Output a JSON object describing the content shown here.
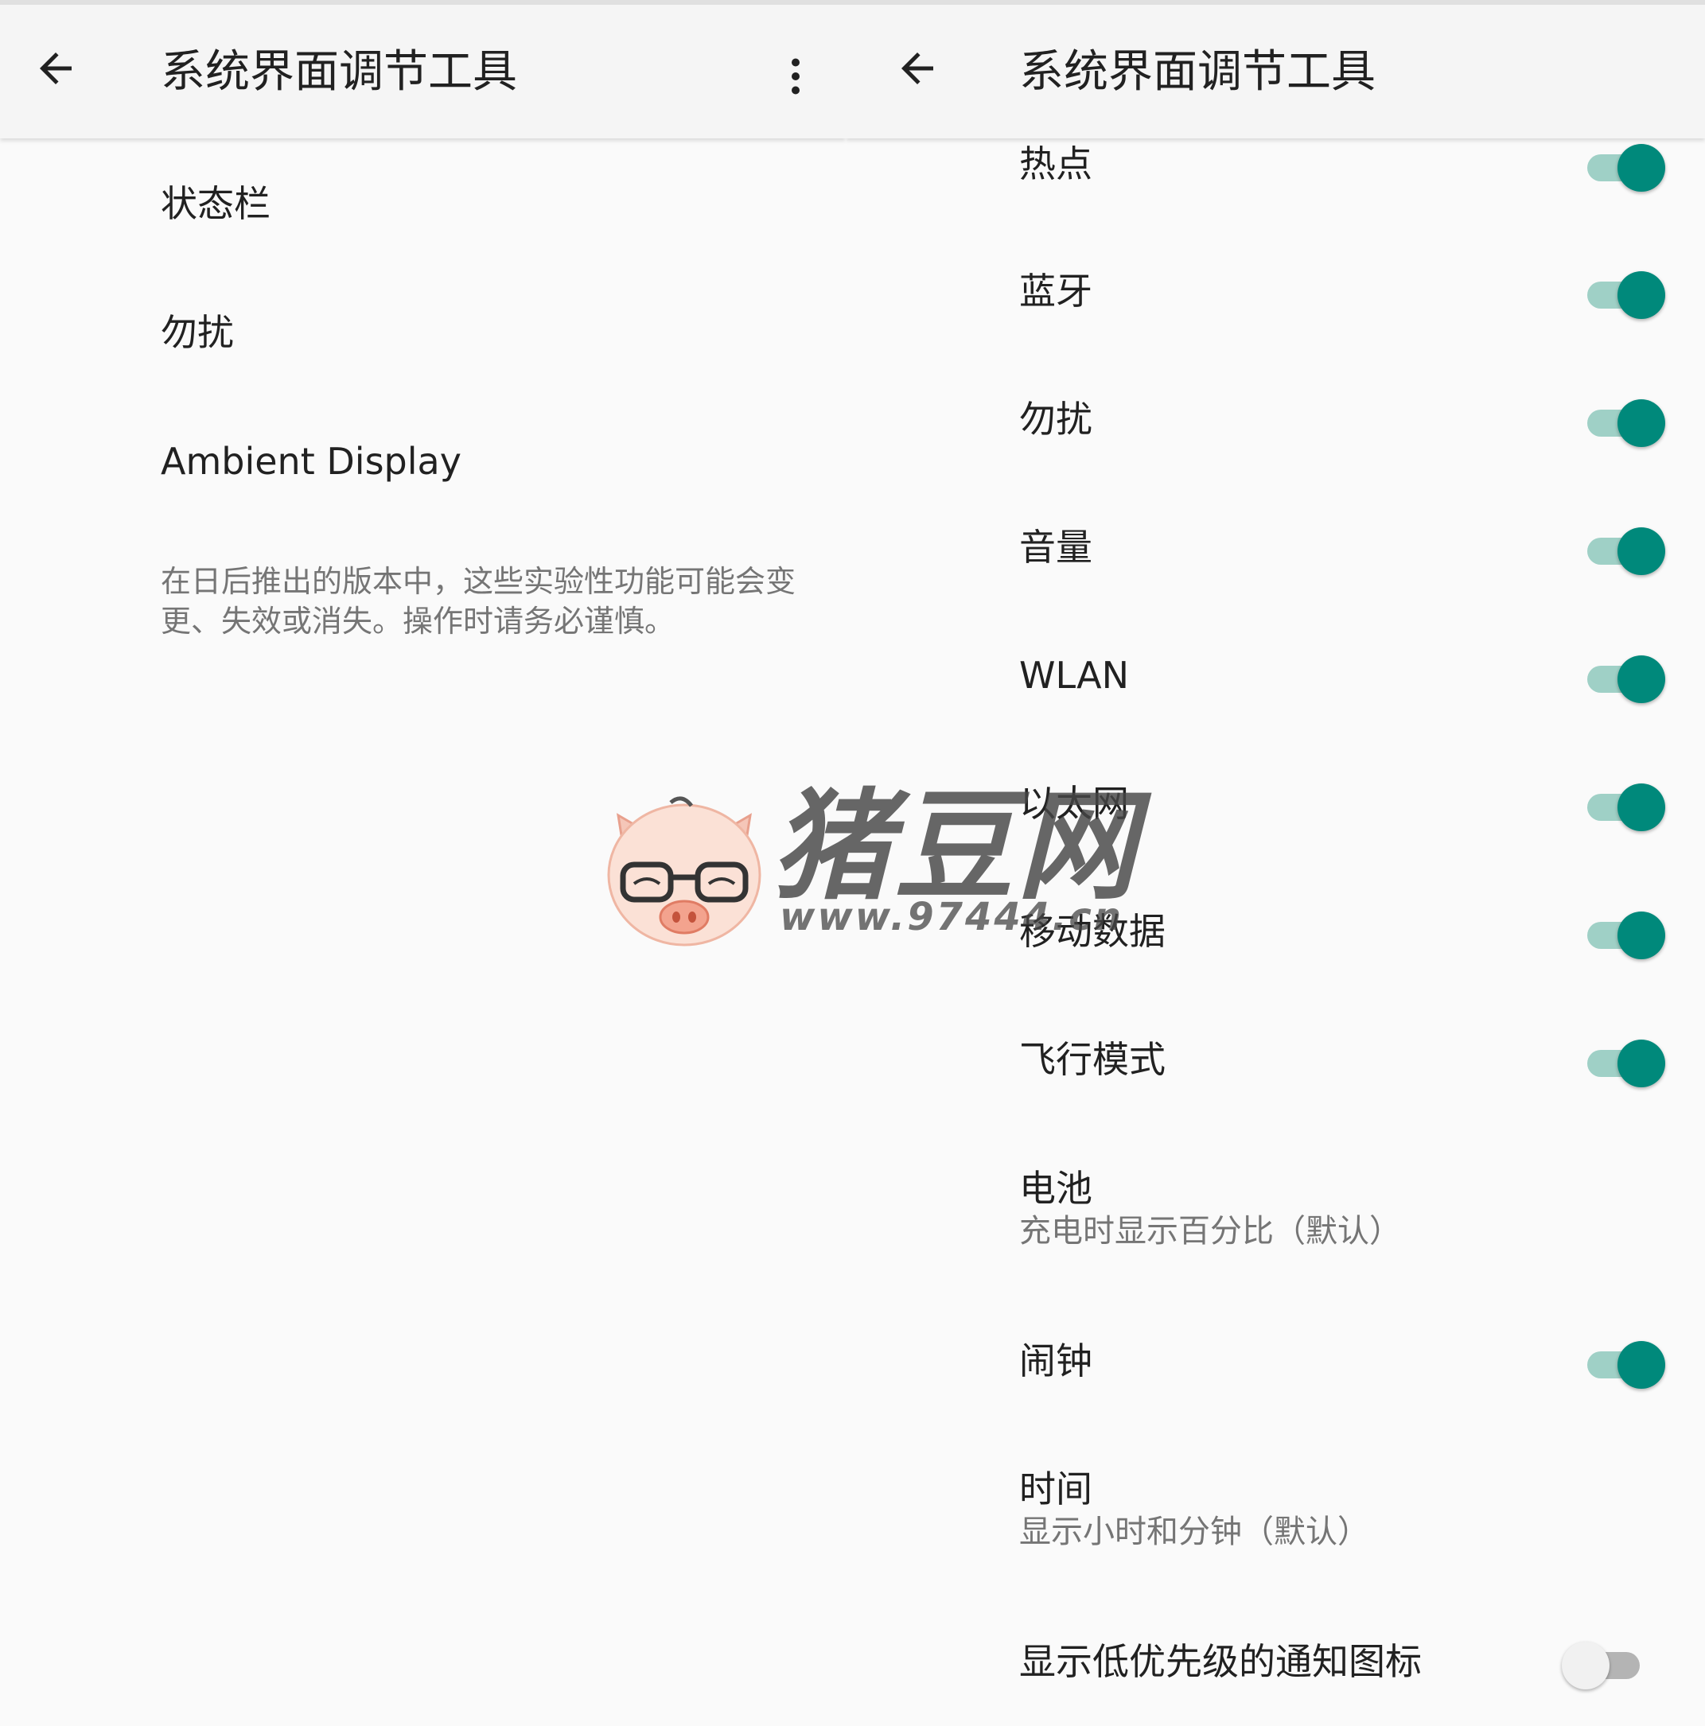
{
  "left_screen": {
    "title": "系统界面调节工具",
    "back_icon": "arrow-left-icon",
    "overflow_icon": "more-vert-icon",
    "menu": [
      {
        "label": "状态栏"
      },
      {
        "label": "勿扰"
      },
      {
        "label": "Ambient Display"
      }
    ],
    "disclaimer": "在日后推出的版本中，这些实验性功能可能会变更、失效或消失。操作时请务必谨慎。"
  },
  "right_screen": {
    "title": "系统界面调节工具",
    "back_icon": "arrow-left-icon",
    "items": [
      {
        "label": "热点",
        "switch": "on"
      },
      {
        "label": "蓝牙",
        "switch": "on"
      },
      {
        "label": "勿扰",
        "switch": "on"
      },
      {
        "label": "音量",
        "switch": "on"
      },
      {
        "label": "WLAN",
        "switch": "on"
      },
      {
        "label": "以太网",
        "switch": "on"
      },
      {
        "label": "移动数据",
        "switch": "on"
      },
      {
        "label": "飞行模式",
        "switch": "on"
      },
      {
        "label": "电池",
        "summary": "充电时显示百分比（默认）"
      },
      {
        "label": "闹钟",
        "switch": "on"
      },
      {
        "label": "时间",
        "summary": "显示小时和分钟（默认）"
      },
      {
        "label": "显示低优先级的通知图标",
        "switch": "off"
      }
    ]
  },
  "watermark": {
    "text": "猪豆网",
    "url": "www.97444.cn",
    "mascot": "pig-mascot-icon"
  },
  "colors": {
    "accent": "#00897b",
    "track_on": "#9fd0c6",
    "appbar": "#f5f5f5",
    "background": "#fafafa"
  }
}
